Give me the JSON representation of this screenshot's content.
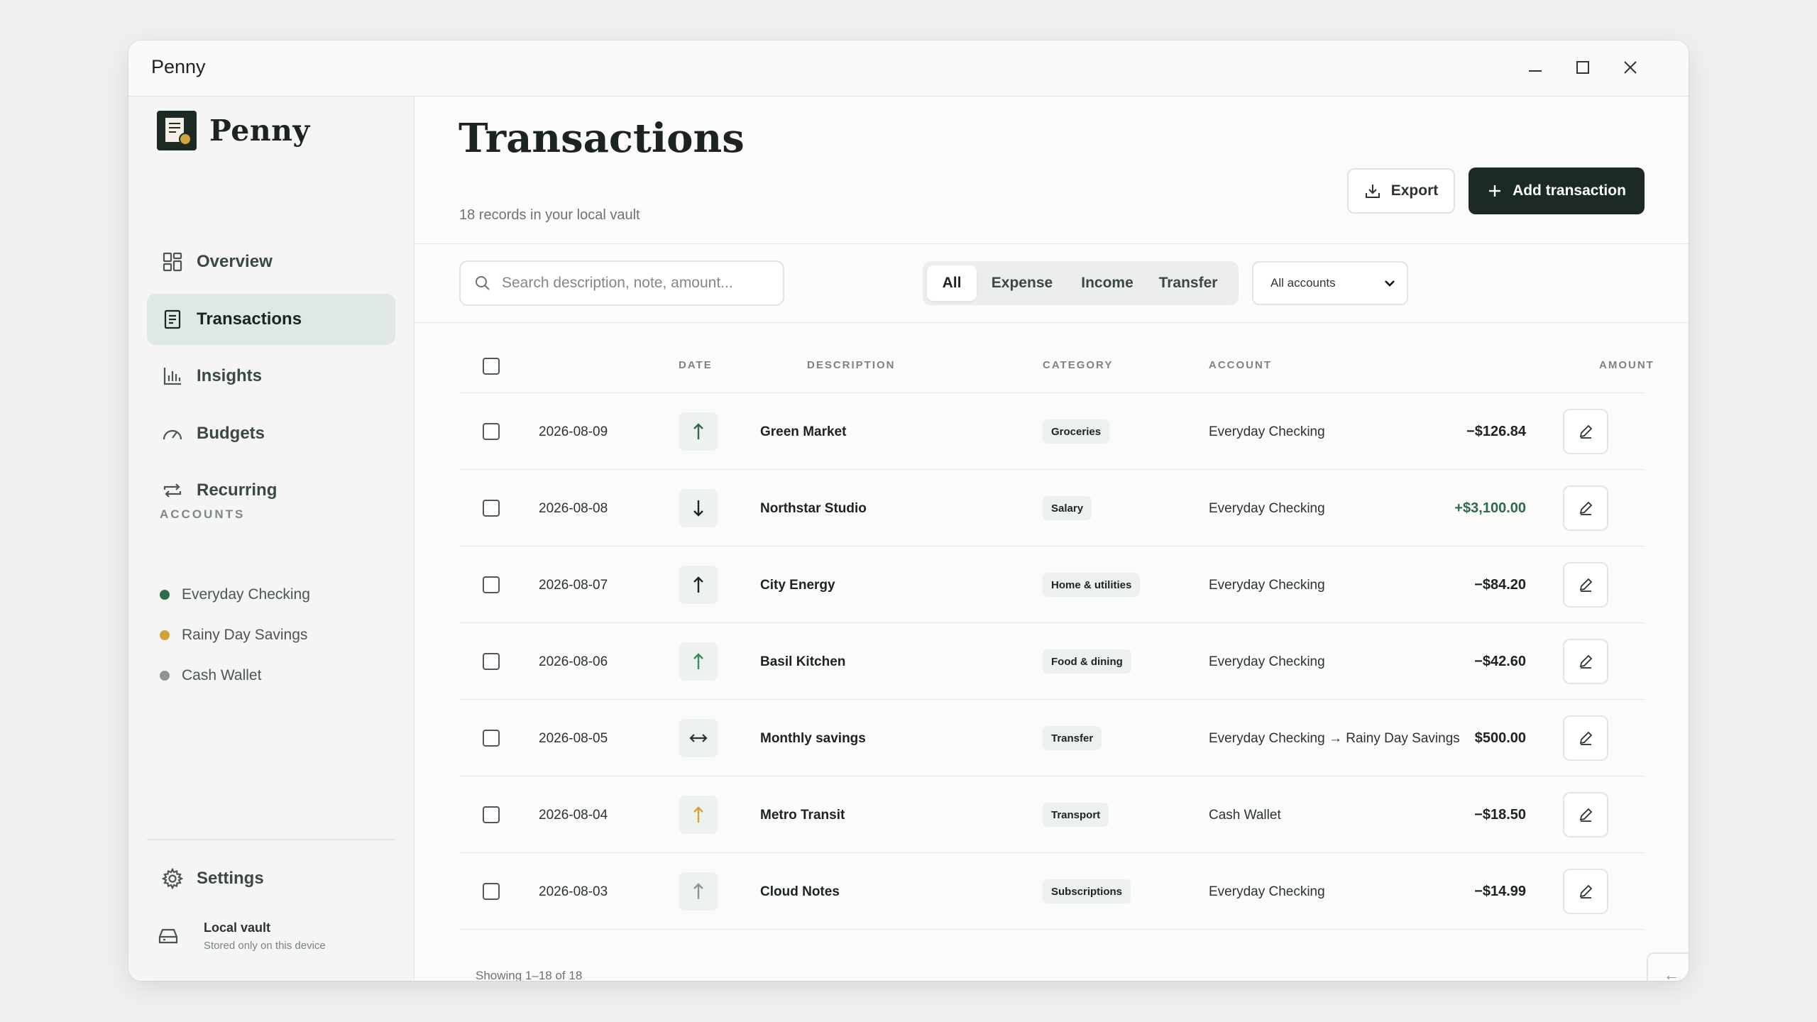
{
  "window": {
    "title": "Penny"
  },
  "brand": {
    "name": "Penny"
  },
  "nav": [
    {
      "label": "Overview",
      "icon": "grid-icon"
    },
    {
      "label": "Transactions",
      "icon": "receipt-icon",
      "active": true
    },
    {
      "label": "Insights",
      "icon": "bar-chart-icon"
    },
    {
      "label": "Budgets",
      "icon": "gauge-icon"
    },
    {
      "label": "Recurring",
      "icon": "repeat-icon"
    }
  ],
  "accounts_label": "ACCOUNTS",
  "accounts": [
    {
      "name": "Everyday Checking",
      "color": "#2e6b4b"
    },
    {
      "name": "Rainy Day Savings",
      "color": "#d4a23a"
    },
    {
      "name": "Cash Wallet",
      "color": "#8e9693"
    }
  ],
  "settings_label": "Settings",
  "vault": {
    "title": "Local vault",
    "subtitle": "Stored only on this device"
  },
  "page": {
    "title": "Transactions",
    "subtitle": "18 records in your local vault"
  },
  "actions": {
    "export": "Export",
    "add": "Add transaction"
  },
  "search": {
    "placeholder": "Search description, note, amount..."
  },
  "filters": [
    "All",
    "Expense",
    "Income",
    "Transfer"
  ],
  "account_filter": {
    "selected": "All accounts"
  },
  "table": {
    "headers": {
      "date": "DATE",
      "description": "DESCRIPTION",
      "category": "CATEGORY",
      "account": "ACCOUNT",
      "amount": "AMOUNT"
    },
    "rows": [
      {
        "date": "2026-08-09",
        "description": "Green Market",
        "category": "Groceries",
        "account": "Everyday Checking",
        "amount": "−$126.84",
        "direction": "out",
        "icon_color": "#2e6b4b"
      },
      {
        "date": "2026-08-08",
        "description": "Northstar Studio",
        "category": "Salary",
        "account": "Everyday Checking",
        "amount": "+$3,100.00",
        "direction": "in",
        "icon_color": "#1b2420"
      },
      {
        "date": "2026-08-07",
        "description": "City Energy",
        "category": "Home & utilities",
        "account": "Everyday Checking",
        "amount": "−$84.20",
        "direction": "out",
        "icon_color": "#1b2420"
      },
      {
        "date": "2026-08-06",
        "description": "Basil Kitchen",
        "category": "Food & dining",
        "account": "Everyday Checking",
        "amount": "−$42.60",
        "direction": "out",
        "icon_color": "#3f8a5f"
      },
      {
        "date": "2026-08-05",
        "description": "Monthly savings",
        "category": "Transfer",
        "account": "Everyday Checking → Rainy Day Savings",
        "amount": "$500.00",
        "direction": "transfer",
        "icon_color": "#2a3530"
      },
      {
        "date": "2026-08-04",
        "description": "Metro Transit",
        "category": "Transport",
        "account": "Cash Wallet",
        "amount": "−$18.50",
        "direction": "out",
        "icon_color": "#d4a23a"
      },
      {
        "date": "2026-08-03",
        "description": "Cloud Notes",
        "category": "Subscriptions",
        "account": "Everyday Checking",
        "amount": "−$14.99",
        "direction": "out",
        "icon_color": "#8e9693"
      }
    ]
  },
  "pagination": {
    "showing": "Showing 1–18 of 18",
    "prev": "←",
    "next": "→"
  }
}
